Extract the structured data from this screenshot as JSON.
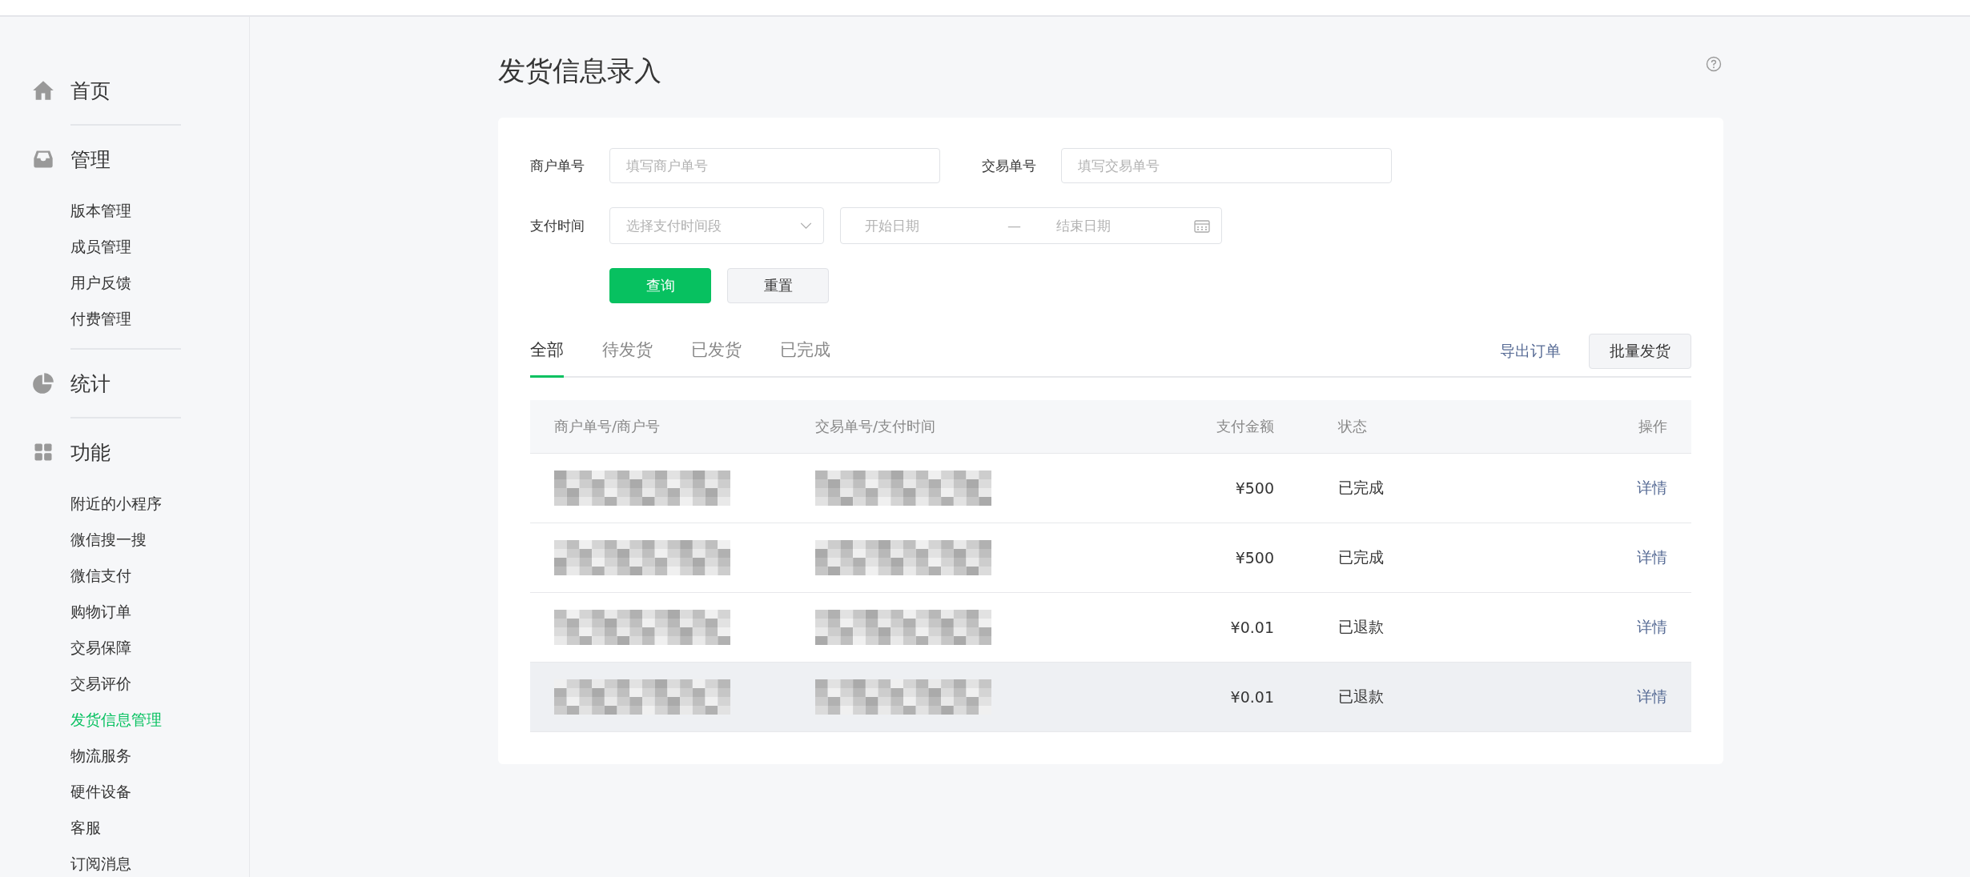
{
  "sidebar": {
    "sections": [
      {
        "label": "首页"
      },
      {
        "label": "管理",
        "children": [
          {
            "label": "版本管理",
            "selected": false
          },
          {
            "label": "成员管理",
            "selected": false
          },
          {
            "label": "用户反馈",
            "selected": false
          },
          {
            "label": "付费管理",
            "selected": false
          }
        ]
      },
      {
        "label": "统计"
      },
      {
        "label": "功能",
        "children": [
          {
            "label": "附近的小程序",
            "selected": false
          },
          {
            "label": "微信搜一搜",
            "selected": false
          },
          {
            "label": "微信支付",
            "selected": false
          },
          {
            "label": "购物订单",
            "selected": false
          },
          {
            "label": "交易保障",
            "selected": false
          },
          {
            "label": "交易评价",
            "selected": false
          },
          {
            "label": "发货信息管理",
            "selected": true
          },
          {
            "label": "物流服务",
            "selected": false
          },
          {
            "label": "硬件设备",
            "selected": false
          },
          {
            "label": "客服",
            "selected": false
          },
          {
            "label": "订阅消息",
            "selected": false
          }
        ]
      }
    ]
  },
  "page": {
    "title": "发货信息录入"
  },
  "form": {
    "merchant_order": {
      "label": "商户单号",
      "placeholder": "填写商户单号"
    },
    "trade_order": {
      "label": "交易单号",
      "placeholder": "填写交易单号"
    },
    "pay_time": {
      "label": "支付时间",
      "select_placeholder": "选择支付时间段",
      "start_placeholder": "开始日期",
      "separator": "—",
      "end_placeholder": "结束日期"
    },
    "buttons": [
      {
        "label": "查询",
        "kind": "primary"
      },
      {
        "label": "重置",
        "kind": "default"
      }
    ]
  },
  "tabs": [
    {
      "label": "全部",
      "selected": true
    },
    {
      "label": "待发货",
      "selected": false
    },
    {
      "label": "已发货",
      "selected": false
    },
    {
      "label": "已完成",
      "selected": false
    }
  ],
  "actions": {
    "export_link": "导出订单",
    "batch_button": "批量发货"
  },
  "table": {
    "columns": [
      "商户单号/商户号",
      "交易单号/支付时间",
      "支付金额",
      "状态",
      "操作"
    ],
    "rows": [
      {
        "amount": "¥500",
        "status": "已完成",
        "action": "详情",
        "highlighted": false
      },
      {
        "amount": "¥500",
        "status": "已完成",
        "action": "详情",
        "highlighted": false
      },
      {
        "amount": "¥0.01",
        "status": "已退款",
        "action": "详情",
        "highlighted": false
      },
      {
        "amount": "¥0.01",
        "status": "已退款",
        "action": "详情",
        "highlighted": true
      }
    ]
  }
}
